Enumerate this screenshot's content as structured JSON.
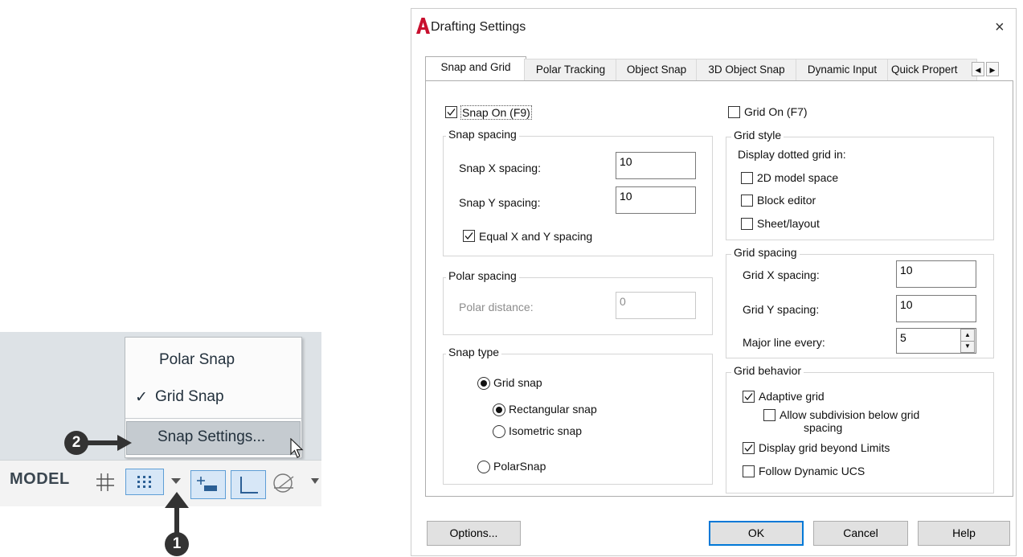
{
  "statusbar": {
    "model_label": "MODEL",
    "menu": {
      "polar_snap": "Polar Snap",
      "grid_snap": "Grid Snap",
      "grid_snap_check": "✓",
      "snap_settings": "Snap Settings..."
    },
    "callouts": [
      "1",
      "2"
    ],
    "icons": [
      "grid-icon",
      "snap-mode-icon",
      "dropdown-arrow-icon",
      "infer-constraints-icon",
      "ortho-icon",
      "polar-tracking-icon"
    ]
  },
  "dialog": {
    "title": "Drafting Settings",
    "close_glyph": "×",
    "tabs": [
      "Snap and Grid",
      "Polar Tracking",
      "Object Snap",
      "3D Object Snap",
      "Dynamic Input",
      "Quick Propert"
    ],
    "tab_scroll": {
      "left": "◀",
      "right": "▶"
    },
    "snap_on": {
      "label": "Snap On (F9)",
      "checked": true
    },
    "grid_on": {
      "label": "Grid On (F7)",
      "checked": false
    },
    "snap_spacing": {
      "title": "Snap spacing",
      "x_label": "Snap X spacing:",
      "x_value": "10",
      "y_label": "Snap Y spacing:",
      "y_value": "10",
      "equal": {
        "label": "Equal X and Y spacing",
        "checked": true
      }
    },
    "polar_spacing": {
      "title": "Polar spacing",
      "distance_label": "Polar distance:",
      "distance_value": "0"
    },
    "snap_type": {
      "title": "Snap type",
      "grid_snap": "Grid snap",
      "rectangular": "Rectangular snap",
      "isometric": "Isometric snap",
      "polarsnap": "PolarSnap",
      "selected": "Grid snap",
      "sub_selected": "Rectangular snap"
    },
    "grid_style": {
      "title": "Grid style",
      "caption": "Display dotted grid in:",
      "model_space": "2D model space",
      "block_editor": "Block editor",
      "sheet_layout": "Sheet/layout"
    },
    "grid_spacing": {
      "title": "Grid spacing",
      "x_label": "Grid X spacing:",
      "x_value": "10",
      "y_label": "Grid Y spacing:",
      "y_value": "10",
      "major_label": "Major line every:",
      "major_value": "5"
    },
    "grid_behavior": {
      "title": "Grid behavior",
      "adaptive": {
        "label": "Adaptive grid",
        "checked": true
      },
      "subdivision": {
        "label": "Allow subdivision below grid",
        "label2": "spacing",
        "checked": false
      },
      "beyond_limits": {
        "label": "Display grid beyond Limits",
        "checked": true
      },
      "follow_ucs": {
        "label": "Follow Dynamic UCS",
        "checked": false
      }
    },
    "buttons": {
      "options": "Options...",
      "ok": "OK",
      "cancel": "Cancel",
      "help": "Help"
    }
  },
  "colors": {
    "accent": "#0078d7",
    "autocad_red": "#c8102e",
    "status_blue": "#5e9ed6"
  }
}
